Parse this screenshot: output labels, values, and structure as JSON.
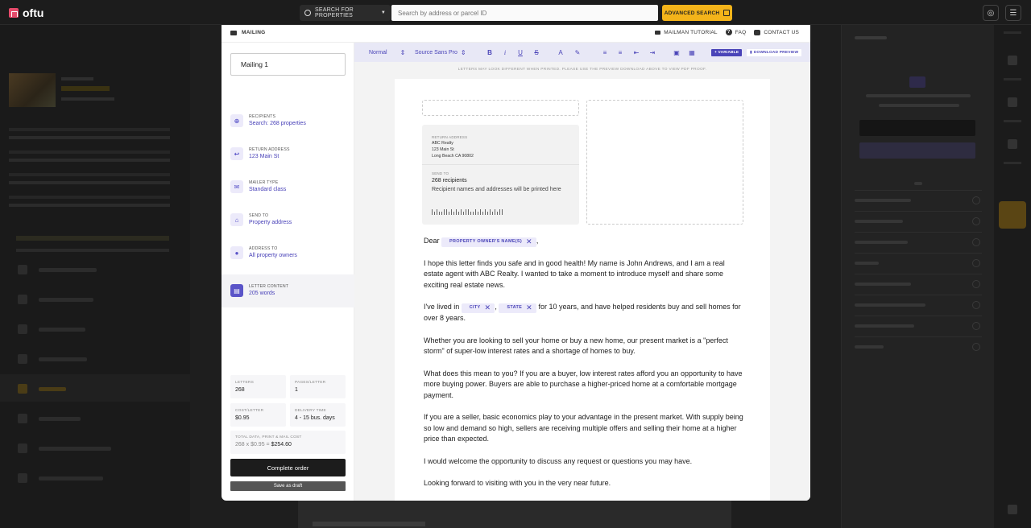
{
  "topbar": {
    "logo": "oftu",
    "search_type": "SEARCH FOR PROPERTIES",
    "search_placeholder": "Search by address or parcel ID",
    "advanced_search": "ADVANCED SEARCH"
  },
  "modal": {
    "title": "MAILING",
    "links": {
      "tutorial": "MAILMAN TUTORIAL",
      "faq": "FAQ",
      "contact": "CONTACT US"
    },
    "mailing_name": "Mailing 1",
    "steps": [
      {
        "label": "RECIPIENTS",
        "value": "Search: 268 properties",
        "icon": "target-icon"
      },
      {
        "label": "RETURN ADDRESS",
        "value": "123 Main St",
        "icon": "return-icon"
      },
      {
        "label": "MAILER TYPE",
        "value": "Standard class",
        "icon": "envelope-icon"
      },
      {
        "label": "SEND TO",
        "value": "Property address",
        "icon": "send-icon"
      },
      {
        "label": "ADDRESS TO",
        "value": "All property owners",
        "icon": "person-icon"
      },
      {
        "label": "LETTER CONTENT",
        "value": "205 words",
        "icon": "document-icon"
      }
    ],
    "stats": {
      "letters_label": "LETTERS",
      "letters": "268",
      "pages_label": "PAGES/LETTER",
      "pages": "1",
      "cost_label": "COST/LETTER",
      "cost": "$0.95",
      "delivery_label": "DELIVERY TIME",
      "delivery": "4 - 15 bus. days",
      "total_label": "TOTAL DATA, PRINT & MAIL COST",
      "total_calc": "268 x $0.95 =",
      "total": "$254.60"
    },
    "complete_order": "Complete order",
    "save_draft": "Save as draft"
  },
  "editor": {
    "style": "Normal",
    "font": "Source Sans Pro",
    "variable_btn": "+ VARIABLE",
    "download_btn": "DOWNLOAD PREVIEW",
    "notice": "LETTERS MAY LOOK DIFFERENT WHEN PRINTED. PLEASE USE THE PREVIEW DOWNLOAD ABOVE TO VIEW PDF PROOF.",
    "envelope": {
      "return_label": "RETURN ADDRESS",
      "return_line1": "ABC Realty",
      "return_line2": "123 Main St",
      "return_line3": "Long Beach CA 90802",
      "send_label": "SEND TO",
      "recipients": "268 recipients",
      "recipients_note": "Recipient names and addresses will be printed here"
    },
    "letter": {
      "dear": "Dear",
      "owner_chip": "PROPERTY OWNER'S NAME(S)",
      "p1": "I hope this letter finds you safe and in good health! My name is John Andrews, and I am a real estate agent with ABC Realty. I wanted to take a moment to introduce myself and share some exciting real estate news.",
      "p2_start": "I've lived in",
      "city_chip": "CITY",
      "state_chip": "STATE",
      "p2_end": "for 10 years, and have helped residents buy and sell homes for over 8 years.",
      "p3": "Whether you are looking to sell your home or buy a new home, our present market is a \"perfect storm\" of super-low interest rates and a shortage of homes to buy.",
      "p4": "What does this mean to you? If you are a buyer, low interest rates afford you an opportunity to have more buying power. Buyers are able to purchase a higher-priced home at a comfortable mortgage payment.",
      "p5": "If you are a seller, basic economics play to your advantage in the present market. With supply being so low and demand so high, sellers are receiving multiple offers and selling their home at a higher price than expected.",
      "p6": "I would welcome the opportunity to discuss any request or questions you may have.",
      "p7": "Looking forward to visiting with you in the very near future."
    }
  }
}
